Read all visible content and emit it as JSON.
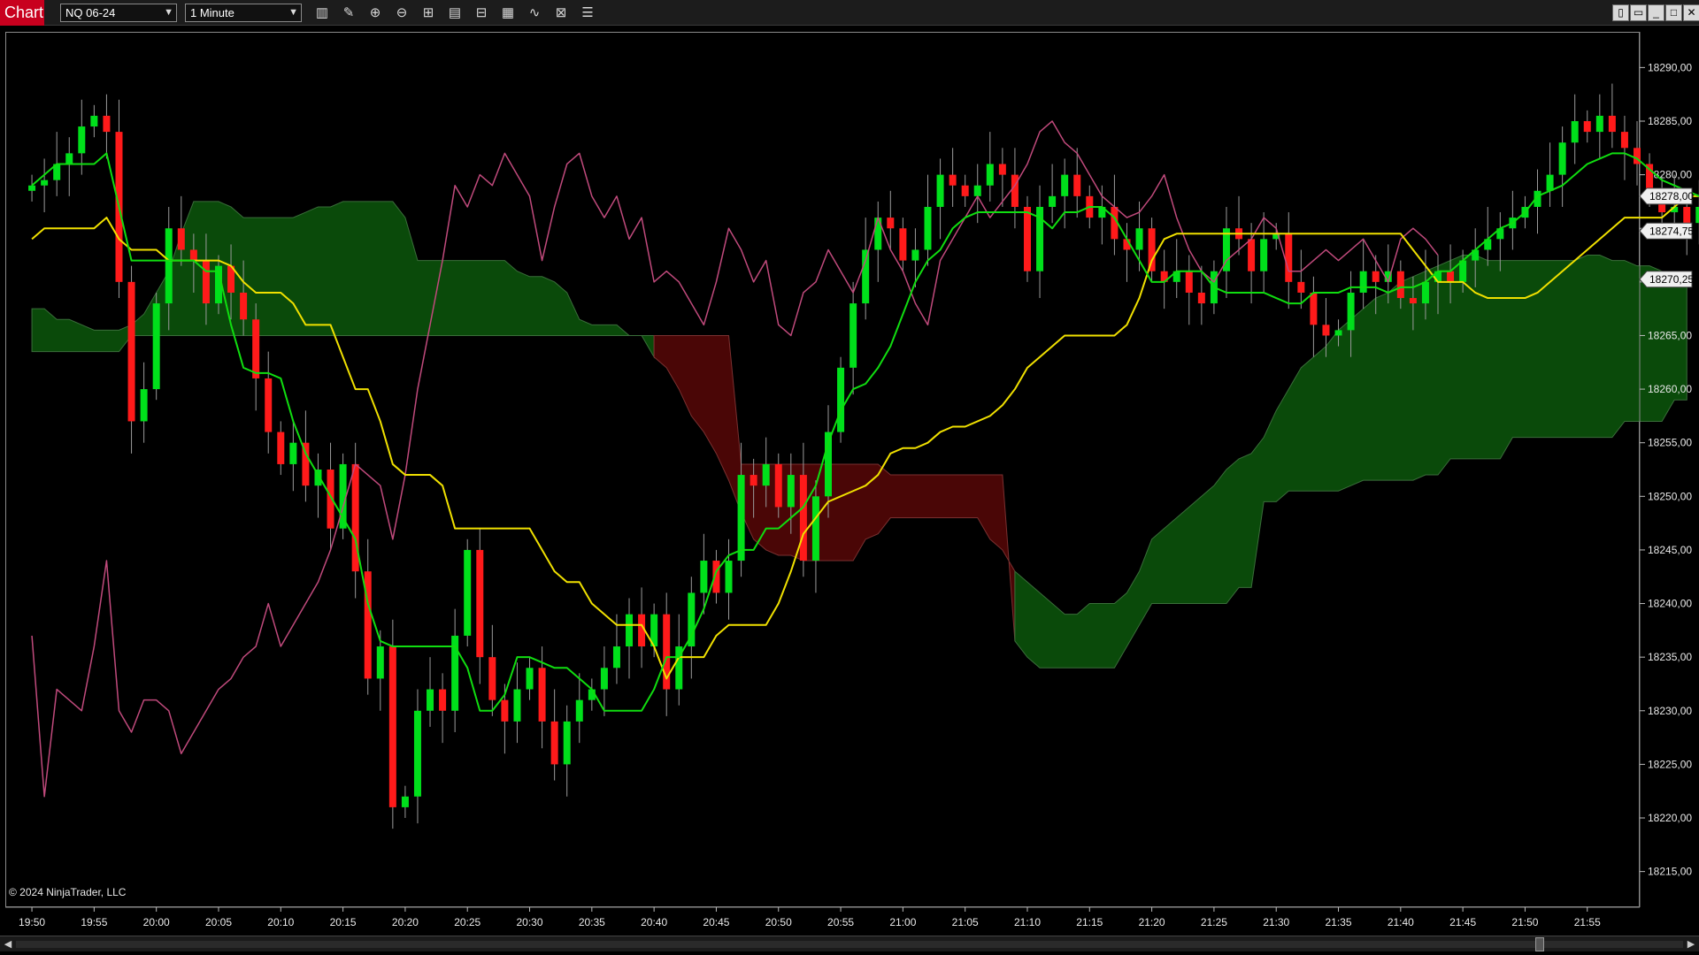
{
  "toolbar": {
    "app_title": "Chart",
    "instrument": "NQ 06-24",
    "interval": "1 Minute",
    "tools": [
      {
        "name": "bar-type-icon",
        "glyph": "▥"
      },
      {
        "name": "drawing-tool-icon",
        "glyph": "✎"
      },
      {
        "name": "zoom-in-icon",
        "glyph": "⊕"
      },
      {
        "name": "zoom-out-icon",
        "glyph": "⊖"
      },
      {
        "name": "crosshair-icon",
        "glyph": "⊞"
      },
      {
        "name": "data-box-icon",
        "glyph": "▤"
      },
      {
        "name": "chart-trader-icon",
        "glyph": "⊟"
      },
      {
        "name": "strategy-icon",
        "glyph": "▦"
      },
      {
        "name": "indicator-icon",
        "glyph": "∿"
      },
      {
        "name": "templates-icon",
        "glyph": "⊠"
      },
      {
        "name": "properties-icon",
        "glyph": "☰"
      }
    ],
    "window_buttons": [
      {
        "name": "tile-icon",
        "glyph": "▯"
      },
      {
        "name": "restore-icon",
        "glyph": "▭"
      },
      {
        "name": "minimize-icon",
        "glyph": "_"
      },
      {
        "name": "maximize-icon",
        "glyph": "□"
      },
      {
        "name": "close-icon",
        "glyph": "✕"
      }
    ]
  },
  "copyright": "© 2024 NinjaTrader, LLC",
  "colors": {
    "background": "#000000",
    "up_candle": "#00e01b",
    "down_candle": "#ff1a1a",
    "tenkan": "#10dd10",
    "kijun": "#f0e000",
    "chikou": "#c04a7c",
    "cloud_bull": "#0a4a0a",
    "cloud_bear": "#4a0606",
    "label_bg": "#f0f0f0"
  },
  "chart_data": {
    "type": "candlestick",
    "x_ticks": [
      "19:50",
      "19:55",
      "20:00",
      "20:05",
      "20:10",
      "20:15",
      "20:20",
      "20:25",
      "20:30",
      "20:35",
      "20:40",
      "20:45",
      "20:50",
      "20:55",
      "21:00",
      "21:05",
      "21:10",
      "21:15",
      "21:20",
      "21:25",
      "21:30",
      "21:35",
      "21:40",
      "21:45",
      "21:50",
      "21:55"
    ],
    "y_ticks": [
      "18290,00",
      "18285,00",
      "18280,00",
      "18275,00",
      "18270,00",
      "18265,00",
      "18260,00",
      "18255,00",
      "18250,00",
      "18245,00",
      "18240,00",
      "18235,00",
      "18230,00",
      "18225,00",
      "18220,00",
      "18215,00"
    ],
    "ylim": [
      18212,
      18293
    ],
    "x_range_minutes": [
      -1,
      129
    ],
    "price_labels": [
      {
        "text": "18278,00",
        "value": 18278.0
      },
      {
        "text": "18274,75",
        "value": 18274.75
      },
      {
        "text": "18270,25",
        "value": 18270.25
      }
    ],
    "closes": [
      18279.0,
      18279.5,
      18281.0,
      18282.0,
      18284.5,
      18285.5,
      18284.0,
      18270.0,
      18257.0,
      18260.0,
      18268.0,
      18275.0,
      18273.0,
      18272.0,
      18268.0,
      18271.5,
      18269.0,
      18266.5,
      18261.0,
      18256.0,
      18253.0,
      18255.0,
      18251.0,
      18252.5,
      18247.0,
      18253.0,
      18243.0,
      18233.0,
      18236.0,
      18221.0,
      18222.0,
      18230.0,
      18232.0,
      18230.0,
      18237.0,
      18245.0,
      18235.0,
      18231.0,
      18229.0,
      18232.0,
      18234.0,
      18229.0,
      18225.0,
      18229.0,
      18231.0,
      18232.0,
      18234.0,
      18236.0,
      18239.0,
      18236.0,
      18239.0,
      18232.0,
      18236.0,
      18241.0,
      18244.0,
      18241.0,
      18244.0,
      18252.0,
      18251.0,
      18253.0,
      18249.0,
      18252.0,
      18244.0,
      18250.0,
      18256.0,
      18262.0,
      18268.0,
      18273.0,
      18276.0,
      18275.0,
      18272.0,
      18273.0,
      18277.0,
      18280.0,
      18279.0,
      18278.0,
      18279.0,
      18281.0,
      18280.0,
      18277.0,
      18271.0,
      18277.0,
      18278.0,
      18280.0,
      18278.0,
      18276.0,
      18277.0,
      18274.0,
      18273.0,
      18275.0,
      18271.0,
      18270.0,
      18271.0,
      18269.0,
      18268.0,
      18271.0,
      18275.0,
      18274.0,
      18271.0,
      18274.0,
      18274.5,
      18270.0,
      18269.0,
      18266.0,
      18265.0,
      18265.5,
      18269.0,
      18271.0,
      18270.0,
      18271.0,
      18268.5,
      18268.0,
      18270.0,
      18271.0,
      18270.0,
      18272.0,
      18273.0,
      18274.0,
      18275.0,
      18276.0,
      18277.0,
      18278.5,
      18280.0,
      18283.0,
      18285.0,
      18284.0,
      18285.5,
      18284.0,
      18282.5,
      18281.0,
      18278.0,
      18276.5,
      18277.0,
      18275.5,
      18277.0,
      18278.0,
      18275.0,
      18272.5,
      18270.25
    ],
    "tenkan": [
      18279.0,
      18280.0,
      18281.0,
      18281.0,
      18281.0,
      18281.0,
      18282.0,
      18277.0,
      18272.0,
      18272.0,
      18272.0,
      18272.0,
      18272.0,
      18272.0,
      18271.0,
      18271.0,
      18266.0,
      18262.0,
      18261.5,
      18261.5,
      18261.0,
      18257.0,
      18254.0,
      18252.0,
      18250.0,
      18248.0,
      18246.0,
      18240.0,
      18236.5,
      18236.0,
      18236.0,
      18236.0,
      18236.0,
      18236.0,
      18236.0,
      18234.0,
      18230.0,
      18230.0,
      18231.5,
      18235.0,
      18235.0,
      18234.5,
      18234.0,
      18234.0,
      18233.0,
      18232.0,
      18230.0,
      18230.0,
      18230.0,
      18230.0,
      18232.0,
      18235.0,
      18235.0,
      18237.0,
      18239.5,
      18243.0,
      18244.5,
      18245.0,
      18245.0,
      18247.0,
      18247.0,
      18248.0,
      18249.0,
      18251.0,
      18255.0,
      18258.0,
      18260.0,
      18260.5,
      18262.0,
      18264.0,
      18267.0,
      18270.0,
      18272.0,
      18273.0,
      18275.0,
      18276.0,
      18276.5,
      18276.5,
      18276.5,
      18276.5,
      18276.5,
      18276.0,
      18275.0,
      18276.5,
      18276.5,
      18277.0,
      18277.0,
      18276.0,
      18274.0,
      18272.0,
      18270.0,
      18270.0,
      18271.0,
      18271.0,
      18271.0,
      18269.5,
      18269.0,
      18269.0,
      18269.0,
      18269.0,
      18268.5,
      18268.0,
      18268.0,
      18269.0,
      18269.0,
      18269.0,
      18269.5,
      18269.5,
      18269.5,
      18269.0,
      18269.5,
      18269.5,
      18270.0,
      18271.0,
      18271.0,
      18272.0,
      18273.0,
      18274.0,
      18275.0,
      18275.5,
      18276.5,
      18278.0,
      18278.5,
      18279.0,
      18280.0,
      18281.0,
      18281.5,
      18282.0,
      18282.0,
      18281.5,
      18280.5,
      18279.5,
      18279.0,
      18278.5,
      18278.0,
      18278.0,
      18277.5,
      18276.5,
      18275.0
    ],
    "kijun": [
      18274.0,
      18275.0,
      18275.0,
      18275.0,
      18275.0,
      18275.0,
      18276.0,
      18274.0,
      18273.0,
      18273.0,
      18273.0,
      18272.0,
      18272.0,
      18272.0,
      18272.0,
      18272.0,
      18271.5,
      18270.0,
      18269.0,
      18269.0,
      18269.0,
      18268.0,
      18266.0,
      18266.0,
      18266.0,
      18263.0,
      18260.0,
      18260.0,
      18257.0,
      18253.0,
      18252.0,
      18252.0,
      18252.0,
      18251.0,
      18247.0,
      18247.0,
      18247.0,
      18247.0,
      18247.0,
      18247.0,
      18247.0,
      18245.0,
      18243.0,
      18242.0,
      18242.0,
      18240.0,
      18239.0,
      18238.0,
      18238.0,
      18238.0,
      18236.0,
      18233.0,
      18235.0,
      18235.0,
      18235.0,
      18237.0,
      18238.0,
      18238.0,
      18238.0,
      18238.0,
      18240.0,
      18243.0,
      18246.5,
      18248.0,
      18249.5,
      18250.0,
      18250.5,
      18251.0,
      18252.0,
      18254.0,
      18254.5,
      18254.5,
      18255.0,
      18256.0,
      18256.5,
      18256.5,
      18257.0,
      18257.5,
      18258.5,
      18260.0,
      18262.0,
      18263.0,
      18264.0,
      18265.0,
      18265.0,
      18265.0,
      18265.0,
      18265.0,
      18266.0,
      18268.5,
      18272.0,
      18274.0,
      18274.5,
      18274.5,
      18274.5,
      18274.5,
      18274.5,
      18274.5,
      18274.5,
      18274.5,
      18274.5,
      18274.5,
      18274.5,
      18274.5,
      18274.5,
      18274.5,
      18274.5,
      18274.5,
      18274.5,
      18274.5,
      18274.5,
      18273.0,
      18271.5,
      18270.0,
      18270.0,
      18270.0,
      18269.0,
      18268.5,
      18268.5,
      18268.5,
      18268.5,
      18269.0,
      18270.0,
      18271.0,
      18272.0,
      18273.0,
      18274.0,
      18275.0,
      18276.0,
      18276.0,
      18276.0,
      18276.0,
      18277.0,
      18278.0,
      18278.0,
      18277.0,
      18276.5,
      18277.0,
      18277.5,
      18278.0
    ],
    "chikou": [
      18237.0,
      18222.0,
      18232.0,
      18231.0,
      18230.0,
      18236.0,
      18244.0,
      18230.0,
      18228.0,
      18231.0,
      18231.0,
      18230.0,
      18226.0,
      18228.0,
      18230.0,
      18232.0,
      18233.0,
      18235.0,
      18236.0,
      18240.0,
      18236.0,
      18238.0,
      18240.0,
      18242.0,
      18245.0,
      18249.0,
      18253.0,
      18252.0,
      18251.0,
      18246.0,
      18252.0,
      18260.0,
      18266.0,
      18272.0,
      18279.0,
      18277.0,
      18280.0,
      18279.0,
      18282.0,
      18280.0,
      18278.0,
      18272.0,
      18277.0,
      18281.0,
      18282.0,
      18278.0,
      18276.0,
      18278.0,
      18274.0,
      18276.0,
      18270.0,
      18271.0,
      18270.0,
      18268.0,
      18266.0,
      18270.0,
      18275.0,
      18273.0,
      18270.0,
      18272.0,
      18266.0,
      18265.0,
      18269.0,
      18270.0,
      18273.0,
      18271.0,
      18269.0,
      18272.0,
      18276.0,
      18273.0,
      18271.0,
      18268.0,
      18266.0,
      18272.0,
      18274.0,
      18276.0,
      18278.0,
      18276.0,
      18277.5,
      18279.0,
      18281.0,
      18284.0,
      18285.0,
      18283.0,
      18282.0,
      18280.0,
      18278.0,
      18277.0,
      18276.0,
      18276.5,
      18278.0,
      18280.0,
      18276.0,
      18273.0,
      18271.0,
      18270.0,
      18272.0,
      18273.0,
      18274.0,
      18276.0,
      18275.0,
      18271.0,
      18271.0,
      18272.0,
      18273.0,
      18272.0,
      18273.0,
      18274.0,
      18272.0,
      18270.0,
      18274.0,
      18275.0,
      18274.0,
      18272.5
    ],
    "span_a": [
      18267.5,
      18267.5,
      18266.5,
      18266.5,
      18266.0,
      18265.5,
      18265.5,
      18265.5,
      18266.0,
      18267.0,
      18269.0,
      18271.0,
      18274.5,
      18277.5,
      18277.5,
      18277.5,
      18277.0,
      18276.0,
      18276.0,
      18276.0,
      18276.0,
      18276.0,
      18276.5,
      18277.0,
      18277.0,
      18277.5,
      18277.5,
      18277.5,
      18277.5,
      18277.5,
      18276.0,
      18272.0,
      18272.0,
      18272.0,
      18272.0,
      18272.0,
      18272.0,
      18272.0,
      18272.0,
      18271.0,
      18270.5,
      18270.5,
      18270.0,
      18269.0,
      18266.5,
      18266.0,
      18266.0,
      18266.0,
      18265.0,
      18265.0,
      18263.0,
      18262.0,
      18260.0,
      18257.5,
      18256.0,
      18254.0,
      18251.5,
      18248.5,
      18246.0,
      18245.0,
      18244.5,
      18244.5,
      18244.0,
      18244.0,
      18244.0,
      18244.0,
      18244.0,
      18246.0,
      18246.5,
      18248.0,
      18248.0,
      18248.0,
      18248.0,
      18248.0,
      18248.0,
      18248.0,
      18248.0,
      18246.0,
      18245.0,
      18243.0,
      18242.0,
      18241.0,
      18240.0,
      18239.0,
      18239.0,
      18240.0,
      18240.0,
      18240.0,
      18241.0,
      18243.0,
      18246.0,
      18247.0,
      18248.0,
      18249.0,
      18250.0,
      18251.0,
      18252.5,
      18253.5,
      18254.0,
      18255.5,
      18258.0,
      18260.0,
      18262.0,
      18263.0,
      18264.0,
      18265.5,
      18266.5,
      18267.5,
      18268.5,
      18269.0,
      18270.0,
      18270.5,
      18271.0,
      18271.5,
      18272.0,
      18272.5,
      18272.5,
      18272.0,
      18272.0,
      18272.0,
      18272.0,
      18272.0,
      18272.0,
      18272.0,
      18272.0,
      18272.5,
      18272.5,
      18272.0,
      18272.0,
      18271.5,
      18271.5,
      18271.0,
      18270.5,
      18270.0
    ],
    "span_b": [
      18263.5,
      18263.5,
      18263.5,
      18263.5,
      18263.5,
      18263.5,
      18263.5,
      18263.5,
      18265.0,
      18265.0,
      18265.0,
      18265.0,
      18265.0,
      18265.0,
      18265.0,
      18265.0,
      18265.0,
      18265.0,
      18265.0,
      18265.0,
      18265.0,
      18265.0,
      18265.0,
      18265.0,
      18265.0,
      18265.0,
      18265.0,
      18265.0,
      18265.0,
      18265.0,
      18265.0,
      18265.0,
      18265.0,
      18265.0,
      18265.0,
      18265.0,
      18265.0,
      18265.0,
      18265.0,
      18265.0,
      18265.0,
      18265.0,
      18265.0,
      18265.0,
      18265.0,
      18265.0,
      18265.0,
      18265.0,
      18265.0,
      18265.0,
      18265.0,
      18265.0,
      18265.0,
      18265.0,
      18265.0,
      18265.0,
      18265.0,
      18253.0,
      18253.0,
      18253.0,
      18253.0,
      18253.0,
      18253.0,
      18253.0,
      18253.0,
      18253.0,
      18253.0,
      18253.0,
      18253.0,
      18252.0,
      18252.0,
      18252.0,
      18252.0,
      18252.0,
      18252.0,
      18252.0,
      18252.0,
      18252.0,
      18252.0,
      18236.5,
      18235.0,
      18234.0,
      18234.0,
      18234.0,
      18234.0,
      18234.0,
      18234.0,
      18234.0,
      18236.0,
      18238.0,
      18240.0,
      18240.0,
      18240.0,
      18240.0,
      18240.0,
      18240.0,
      18240.0,
      18241.5,
      18241.5,
      18249.5,
      18249.5,
      18250.5,
      18250.5,
      18250.5,
      18250.5,
      18250.5,
      18251.0,
      18251.5,
      18251.5,
      18251.5,
      18251.5,
      18251.5,
      18252.0,
      18252.0,
      18253.5,
      18253.5,
      18253.5,
      18253.5,
      18253.5,
      18255.5,
      18255.5,
      18255.5,
      18255.5,
      18255.5,
      18255.5,
      18255.5,
      18255.5,
      18255.5,
      18257.0,
      18257.0,
      18257.0,
      18257.0,
      18259.0,
      18259.0,
      18259.0,
      18259.0,
      18261.0,
      18263.0,
      18264.0,
      18265.0
    ]
  }
}
